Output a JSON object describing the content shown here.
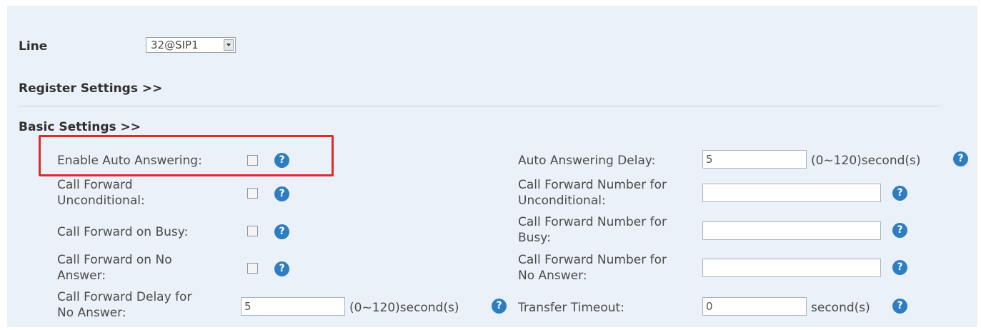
{
  "line": {
    "label": "Line",
    "selected": "32@SIP1"
  },
  "sections": {
    "register": "Register Settings >>",
    "basic": "Basic Settings >>"
  },
  "fields": {
    "enable_auto_answering": {
      "label": "Enable Auto Answering:",
      "checked": false
    },
    "auto_answering_delay": {
      "label": "Auto Answering Delay:",
      "value": "5",
      "unit": "(0~120)second(s)"
    },
    "cf_unconditional": {
      "label_line1": "Call Forward",
      "label_line2": "Unconditional:",
      "checked": false
    },
    "cf_number_unconditional": {
      "label_line1": "Call Forward Number for",
      "label_line2": "Unconditional:",
      "value": ""
    },
    "cf_busy": {
      "label": "Call Forward on Busy:",
      "checked": false
    },
    "cf_number_busy": {
      "label_line1": "Call Forward Number for",
      "label_line2": "Busy:",
      "value": ""
    },
    "cf_no_answer": {
      "label_line1": "Call Forward on No",
      "label_line2": "Answer:",
      "checked": false
    },
    "cf_number_no_answer": {
      "label_line1": "Call Forward Number for",
      "label_line2": "No Answer:",
      "value": ""
    },
    "cf_delay_no_answer": {
      "label_line1": "Call Forward Delay for",
      "label_line2": "No Answer:",
      "value": "5",
      "unit": "(0~120)second(s)"
    },
    "transfer_timeout": {
      "label": "Transfer Timeout:",
      "value": "0",
      "unit": "second(s)"
    }
  },
  "help_glyph": "?",
  "icons": {
    "help": "help-circle-icon",
    "dropdown": "chevron-down-icon"
  },
  "colors": {
    "highlight": "#e02a2a",
    "help": "#2e7dc0",
    "panel": "#eaf1f8"
  }
}
